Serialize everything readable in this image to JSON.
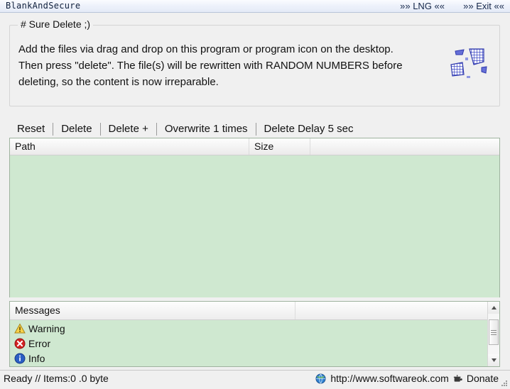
{
  "titlebar": {
    "app_title": "BlankAndSecure",
    "lng_button": "»» LNG ««",
    "exit_button": "»» Exit ««"
  },
  "groupbox": {
    "title": "# Sure Delete ;)",
    "description_lines": [
      "Add the files via drag and drop on this program or program icon on the desktop.",
      "Then press \"delete\". The file(s) will be rewritten with RANDOM NUMBERS before",
      "deleting, so the content is now irreparable."
    ],
    "icon": "shredded-grid-icon"
  },
  "toolbar": {
    "items": [
      {
        "label": "Reset",
        "name": "reset-button"
      },
      {
        "label": "Delete",
        "name": "delete-button"
      },
      {
        "label": "Delete +",
        "name": "delete-plus-button"
      },
      {
        "label": "Overwrite 1 times",
        "name": "overwrite-times-button"
      },
      {
        "label": "Delete Delay 5 sec",
        "name": "delete-delay-button"
      }
    ]
  },
  "filelist": {
    "columns": [
      "Path",
      "Size",
      ""
    ],
    "rows": []
  },
  "messages": {
    "columns": [
      "Messages",
      ""
    ],
    "rows": [
      {
        "icon": "warning-icon",
        "label": "Warning"
      },
      {
        "icon": "error-icon",
        "label": "Error"
      },
      {
        "icon": "info-icon",
        "label": "Info"
      }
    ]
  },
  "statusbar": {
    "status_text": "Ready // Items:0 .0 byte",
    "website": "http://www.softwareok.com",
    "donate": "Donate"
  },
  "colors": {
    "list_background": "#cfe8d0",
    "window_background": "#f0f0f0",
    "title_text": "#10203c",
    "warning": "#f3c13a",
    "error": "#cc1f1f",
    "info": "#2b5fc4",
    "icon_blue": "#3b46c4"
  }
}
